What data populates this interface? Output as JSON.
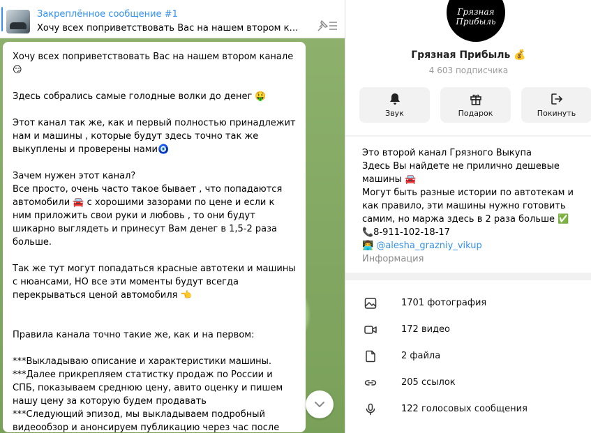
{
  "pinned": {
    "title": "Закреплённое сообщение #1",
    "preview": "Хочу всех поприветствовать Вас на нашем втором канале..."
  },
  "message": {
    "paragraphs": [
      "Хочу всех поприветствовать Вас на нашем втором канале😏",
      "Здесь собрались самые голодные волки до денег 🤑",
      "Этот канал так же, как и первый полностью принадлежит нам и машины , которые будут здесь точно так же выкуплены и проверены нами🧿",
      "Зачем нужен этот канал?\nВсе просто, очень часто такое бывает , что попадаются автомобили 🚘 с хорошими зазорами по цене и если к ним приложить свои руки и любовь , то они будут шикарно выглядеть и принесут Вам денег в 1,5-2 раза больше.",
      "Так же тут могут попадаться красные автотеки и машины с нюансами, НО все эти моменты будут всегда перекрываться ценой автомобиля 👈",
      "\n\nПравила канала точно такие же, как и на первом:",
      "***Выкладываю описание и характеристики машины.\n***Далее прикрепляем статистку продаж по России и СПБ, показываем среднюю цену, авито оценку и пишем нашу цену за которую будем продавать\n***Следующий эпизод, мы выкладываем подробный видеообзор и анонсируем публикацию через час после видеообзора."
    ]
  },
  "channel": {
    "avatar_text": "Грязная Прибыль",
    "name": "Грязная Прибыль 💰",
    "subscribers": "4 603 подписчика",
    "actions": [
      {
        "label": "Звук",
        "icon": "bell-icon"
      },
      {
        "label": "Подарок",
        "icon": "gift-icon"
      },
      {
        "label": "Покинуть",
        "icon": "leave-icon"
      }
    ],
    "about": {
      "line1": "Это второй канал Грязного Выкупа",
      "line2": "Здесь Вы найдете не прилично дешевые машины 🚘",
      "line3": "Могут быть разные истории по автотекам и как правило, эти машины нужно готовить самим, но маржа здесь в 2 раза больше ✅",
      "phone": "📞8-911-102-18-17",
      "contact_prefix": "👨‍💻 ",
      "contact_link": "@alesha_grazniy_vikup",
      "label": "Информация"
    },
    "media": [
      {
        "label": "1701 фотография",
        "icon": "photo-icon"
      },
      {
        "label": "172 видео",
        "icon": "video-icon"
      },
      {
        "label": "2 файла",
        "icon": "file-icon"
      },
      {
        "label": "205 ссылок",
        "icon": "link-icon"
      },
      {
        "label": "122 голосовых сообщения",
        "icon": "microphone-icon"
      }
    ]
  },
  "colors": {
    "accent": "#3390ec",
    "chat_background": "#7fa463"
  }
}
